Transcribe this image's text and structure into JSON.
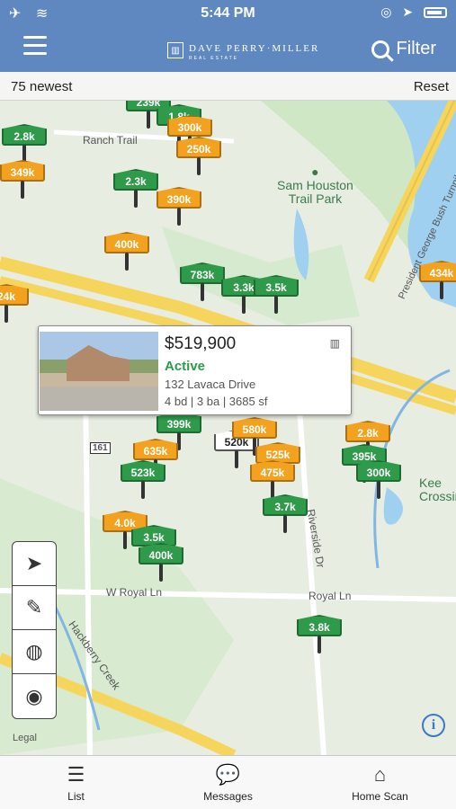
{
  "status_bar": {
    "time": "5:44 PM",
    "left_icons": "✈ ≋",
    "right_icons": "◎ ➤"
  },
  "header": {
    "logo_name": "DAVE PERRY·MILLER",
    "logo_sub": "REAL ESTATE",
    "filter_label": "Filter"
  },
  "subbar": {
    "newest_label": "75 newest",
    "reset_label": "Reset"
  },
  "map": {
    "road_labels": [
      "Ranch Trail",
      "W Royal Ln",
      "Royal Ln",
      "Hackberry Creek",
      "Riverside Dr",
      "President George Bush Turnpike N",
      "161"
    ],
    "park_label": [
      "Sam Houston",
      "Trail Park"
    ],
    "keen_label": [
      "Kee",
      "Crossin"
    ],
    "legal": "Legal",
    "pins": [
      {
        "label": "239k",
        "color": "green"
      },
      {
        "label": "1.8k",
        "color": "green"
      },
      {
        "label": "300k",
        "color": "orange"
      },
      {
        "label": "2.8k",
        "color": "green"
      },
      {
        "label": "250k",
        "color": "orange"
      },
      {
        "label": "349k",
        "color": "orange"
      },
      {
        "label": "2.3k",
        "color": "green"
      },
      {
        "label": "390k",
        "color": "orange"
      },
      {
        "label": "400k",
        "color": "orange"
      },
      {
        "label": "783k",
        "color": "green"
      },
      {
        "label": "3.3k",
        "color": "green"
      },
      {
        "label": "3.5k",
        "color": "green"
      },
      {
        "label": "434k",
        "color": "orange"
      },
      {
        "label": "24k",
        "color": "orange"
      },
      {
        "label": "399k",
        "color": "green"
      },
      {
        "label": "635k",
        "color": "orange"
      },
      {
        "label": "520k",
        "color": "white"
      },
      {
        "label": "580k",
        "color": "orange"
      },
      {
        "label": "525k",
        "color": "orange"
      },
      {
        "label": "475k",
        "color": "orange"
      },
      {
        "label": "523k",
        "color": "green"
      },
      {
        "label": "2.8k",
        "color": "orange"
      },
      {
        "label": "395k",
        "color": "green"
      },
      {
        "label": "300k",
        "color": "green"
      },
      {
        "label": "3.7k",
        "color": "green"
      },
      {
        "label": "4.0k",
        "color": "orange"
      },
      {
        "label": "3.5k",
        "color": "green"
      },
      {
        "label": "400k",
        "color": "green"
      },
      {
        "label": "3.8k",
        "color": "green"
      }
    ]
  },
  "popup": {
    "price": "$519,900",
    "status": "Active",
    "address": "132 Lavaca Drive",
    "details": "4 bd | 3 ba | 3685 sf"
  },
  "tools": [
    "navigate-arrow-icon",
    "draw-pencil-icon",
    "road-view-icon",
    "globe-icon"
  ],
  "tabs": [
    {
      "label": "List",
      "icon": "list-icon"
    },
    {
      "label": "Messages",
      "icon": "messages-icon"
    },
    {
      "label": "Home Scan",
      "icon": "home-scan-icon"
    }
  ],
  "colors": {
    "header": "#5f88c0",
    "green_pin": "#2e9a4a",
    "orange_pin": "#f3a21f",
    "road_yellow": "#f6d55c"
  }
}
